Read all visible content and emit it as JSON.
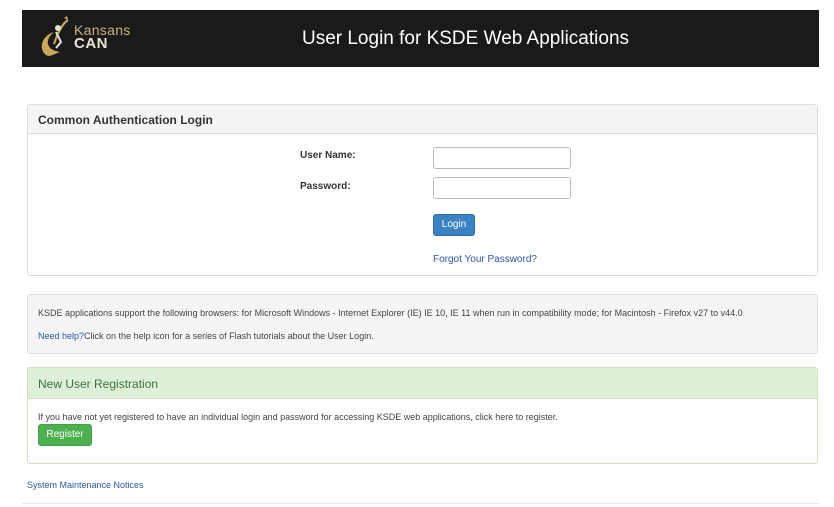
{
  "header": {
    "logo_line1": "Kansans",
    "logo_line2": "CAN",
    "title": "User Login for KSDE Web Applications"
  },
  "login_panel": {
    "heading": "Common Authentication Login",
    "username_label": "User Name:",
    "username_value": "",
    "password_label": "Password:",
    "password_value": "",
    "login_button": "Login",
    "forgot_link": "Forgot Your Password?"
  },
  "info_panel": {
    "browsers_text": "KSDE applications support the following browsers: for Microsoft Windows - Internet Explorer (IE) IE 10, IE 11 when run in compatibility mode; for Macintosh - Firefox v27 to v44.0",
    "help_link": "Need help?",
    "help_text": "Click on the help icon for a series of Flash tutorials about the User Login."
  },
  "registration_panel": {
    "heading": "New User Registration",
    "text": "If you have not yet registered to have an individual login and password for accessing KSDE web applications, click here to register.",
    "register_button": "Register"
  },
  "footer": {
    "maintenance_link": "System Maintenance Notices"
  },
  "colors": {
    "header_bg": "#1a1a1a",
    "login_button": "#3b82c4",
    "register_button": "#4caf50",
    "registration_header_bg": "#dff0d8",
    "link": "#2b56a8"
  },
  "icons": {
    "logo": "kansans-can-logo"
  }
}
